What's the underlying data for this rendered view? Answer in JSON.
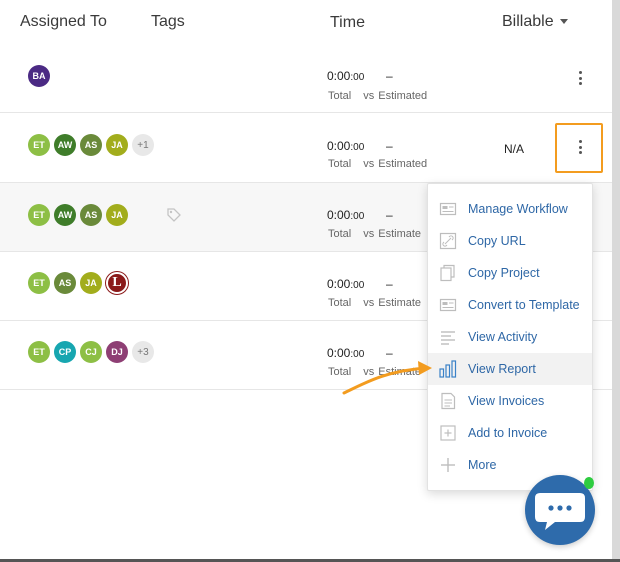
{
  "header": {
    "assigned_to": "Assigned To",
    "tags": "Tags",
    "time": "Time",
    "billable": "Billable"
  },
  "rows": [
    {
      "avatars": [
        {
          "initials": "BA",
          "color": "#4b2a84"
        }
      ],
      "time": "0:00",
      "time_small": ":00",
      "dash": "–",
      "total": "Total",
      "vs": "vs",
      "estimated": "Estimated",
      "billable": ""
    },
    {
      "avatars": [
        {
          "initials": "ET",
          "color": "#8dbf45"
        },
        {
          "initials": "AW",
          "color": "#3f7d2a"
        },
        {
          "initials": "AS",
          "color": "#6a8a3a"
        },
        {
          "initials": "JA",
          "color": "#a2ad1c"
        }
      ],
      "plus": "+1",
      "time": "0:00",
      "time_small": ":00",
      "dash": "–",
      "total": "Total",
      "vs": "vs",
      "estimated": "Estimated",
      "billable": "N/A"
    },
    {
      "avatars": [
        {
          "initials": "ET",
          "color": "#8dbf45"
        },
        {
          "initials": "AW",
          "color": "#3f7d2a"
        },
        {
          "initials": "AS",
          "color": "#6a8a3a"
        },
        {
          "initials": "JA",
          "color": "#a2ad1c"
        }
      ],
      "time": "0:00",
      "time_small": ":00",
      "dash": "–",
      "total": "Total",
      "vs": "vs",
      "estimated": "Estimate"
    },
    {
      "avatars": [
        {
          "initials": "ET",
          "color": "#8dbf45"
        },
        {
          "initials": "AS",
          "color": "#6a8a3a"
        },
        {
          "initials": "JA",
          "color": "#a2ad1c"
        },
        {
          "initials": "L",
          "color": "#8b1a1a"
        }
      ],
      "time": "0:00",
      "time_small": ":00",
      "dash": "–",
      "total": "Total",
      "vs": "vs",
      "estimated": "Estimate"
    },
    {
      "avatars": [
        {
          "initials": "ET",
          "color": "#8dbf45"
        },
        {
          "initials": "CP",
          "color": "#17a6b0"
        },
        {
          "initials": "CJ",
          "color": "#8dbf45"
        },
        {
          "initials": "DJ",
          "color": "#8e3f74"
        }
      ],
      "plus": "+3",
      "time": "0:00",
      "time_small": ":00",
      "dash": "–",
      "total": "Total",
      "vs": "vs",
      "estimated": "Estimate"
    }
  ],
  "menu": {
    "items": [
      {
        "label": "Manage Workflow",
        "icon": "workflow-icon"
      },
      {
        "label": "Copy URL",
        "icon": "link-icon"
      },
      {
        "label": "Copy Project",
        "icon": "copy-icon"
      },
      {
        "label": "Convert to Template",
        "icon": "template-icon"
      },
      {
        "label": "View Activity",
        "icon": "activity-icon"
      },
      {
        "label": "View Report",
        "icon": "bar-chart-icon"
      },
      {
        "label": "View Invoices",
        "icon": "invoice-icon"
      },
      {
        "label": "Add to Invoice",
        "icon": "add-invoice-icon"
      },
      {
        "label": "More",
        "icon": "plus-icon"
      }
    ],
    "highlighted": "View Report"
  },
  "colors": {
    "accent_orange": "#f39c1f",
    "link_blue": "#2e67a6",
    "chat_blue": "#2e6bab",
    "online_green": "#2ecc40"
  }
}
